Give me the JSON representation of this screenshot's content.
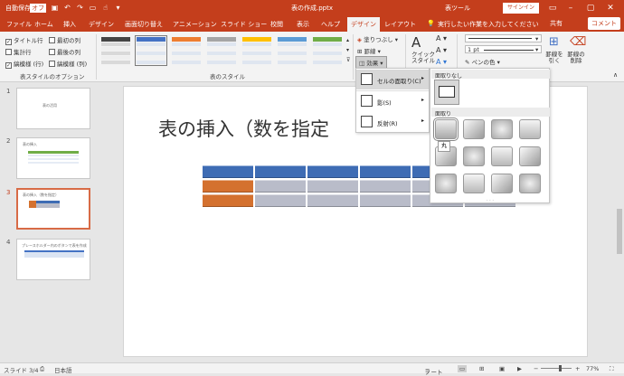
{
  "titlebar": {
    "autosave": "自動保存",
    "autosave_state": "オフ",
    "filename": "表の作成.pptx",
    "context_group": "表ツール",
    "signin": "サインイン",
    "brand_color": "#c43e1c"
  },
  "tabs": [
    "ファイル",
    "ホーム",
    "挿入",
    "デザイン",
    "画面切り替え",
    "アニメーション",
    "スライド ショー",
    "校閲",
    "表示",
    "ヘルプ",
    "デザイン",
    "レイアウト"
  ],
  "tell_me": "実行したい作業を入力してください",
  "share": "共有",
  "comment": "コメント",
  "style_options": {
    "items": [
      {
        "label": "タイトル行",
        "checked": true
      },
      {
        "label": "集計行",
        "checked": false
      },
      {
        "label": "縞模様 (行)",
        "checked": true
      },
      {
        "label": "最初の列",
        "checked": false
      },
      {
        "label": "最後の列",
        "checked": false
      },
      {
        "label": "縞模様 (列)",
        "checked": false
      }
    ],
    "group_label": "表スタイルのオプション"
  },
  "table_styles": {
    "group_label": "表のスタイル",
    "swatches": [
      "#444444",
      "#4472c4",
      "#ed7d31",
      "#a5a5a5",
      "#ffc000",
      "#5b9bd5",
      "#70ad47"
    ]
  },
  "ribbon_buttons": {
    "shading": "塗りつぶし",
    "border": "罫線",
    "effects": "効果",
    "quick_styles": "クイック スタイル",
    "pen_weight": "1 pt",
    "pen_color": "ペンの色",
    "draw_table": "罫線を引く",
    "eraser": "罫線の削除"
  },
  "slides": [
    {
      "num": "1",
      "title": "表の活用"
    },
    {
      "num": "2",
      "title": "表の挿入"
    },
    {
      "num": "3",
      "title": "表の挿入（数を指定）"
    },
    {
      "num": "4",
      "title": "プレースホルダー内のボタンで表を作成"
    }
  ],
  "main_slide": {
    "title": "表の挿入（数を指定"
  },
  "effects_menu": [
    {
      "label": "セルの面取り(C)"
    },
    {
      "label": "影(S)"
    },
    {
      "label": "反射(R)"
    }
  ],
  "bevel_gallery": {
    "none_header": "面取りなし",
    "bevel_header": "面取り",
    "tooltip": "丸"
  },
  "statusbar": {
    "slide_info": "スライド 3/4",
    "language": "日本語",
    "notes": "ノート",
    "zoom": "77%"
  },
  "table_colors": {
    "header": "#3e6cb4",
    "first_col": "#d4712f",
    "body": "#b9bcc9"
  }
}
